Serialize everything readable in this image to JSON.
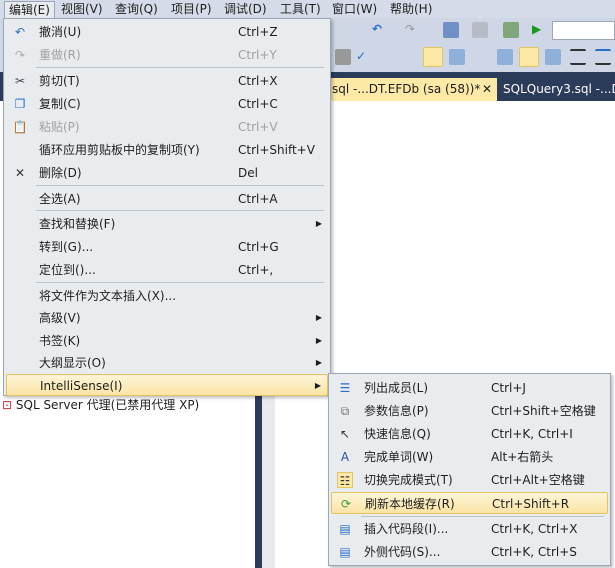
{
  "menubar": [
    "编辑(E)",
    "视图(V)",
    "查询(Q)",
    "项目(P)",
    "调试(D)",
    "工具(T)",
    "窗口(W)",
    "帮助(H)"
  ],
  "tabs": {
    "active": "sql -...DT.EFDb (sa (58))*",
    "close": "✕",
    "second": "SQLQuery3.sql -...D"
  },
  "tree_item": "SQL Server 代理(已禁用代理 XP)",
  "edit_menu": [
    {
      "label": "撤消(U)",
      "shortcut": "Ctrl+Z",
      "icon": "undo-icon"
    },
    {
      "label": "重做(R)",
      "shortcut": "Ctrl+Y",
      "icon": "redo-icon",
      "disabled": true
    },
    {
      "label": "剪切(T)",
      "shortcut": "Ctrl+X",
      "icon": "scissors-icon"
    },
    {
      "label": "复制(C)",
      "shortcut": "Ctrl+C",
      "icon": "copy-icon"
    },
    {
      "label": "粘贴(P)",
      "shortcut": "Ctrl+V",
      "icon": "paste-icon",
      "disabled": true
    },
    {
      "label": "循环应用剪贴板中的复制项(Y)",
      "shortcut": "Ctrl+Shift+V"
    },
    {
      "label": "删除(D)",
      "shortcut": "Del",
      "icon": "delete-icon"
    },
    {
      "label": "全选(A)",
      "shortcut": "Ctrl+A"
    },
    {
      "label": "查找和替换(F)",
      "shortcut": "",
      "submenu": true
    },
    {
      "label": "转到(G)...",
      "shortcut": "Ctrl+G"
    },
    {
      "label": "定位到()...",
      "shortcut": "Ctrl+,"
    },
    {
      "label": "将文件作为文本插入(X)...",
      "shortcut": ""
    },
    {
      "label": "高级(V)",
      "shortcut": "",
      "submenu": true
    },
    {
      "label": "书签(K)",
      "shortcut": "",
      "submenu": true
    },
    {
      "label": "大纲显示(O)",
      "shortcut": "",
      "submenu": true
    },
    {
      "label": "IntelliSense(I)",
      "shortcut": "",
      "submenu": true,
      "highlighted": true
    }
  ],
  "intellisense_menu": [
    {
      "label": "列出成员(L)",
      "shortcut": "Ctrl+J",
      "icon": "list-members-icon"
    },
    {
      "label": "参数信息(P)",
      "shortcut": "Ctrl+Shift+空格键",
      "icon": "parameter-info-icon"
    },
    {
      "label": "快速信息(Q)",
      "shortcut": "Ctrl+K, Ctrl+I",
      "icon": "quick-info-icon"
    },
    {
      "label": "完成单词(W)",
      "shortcut": "Alt+右箭头",
      "icon": "complete-word-icon"
    },
    {
      "label": "切换完成模式(T)",
      "shortcut": "Ctrl+Alt+空格键",
      "icon": "toggle-completion-icon"
    },
    {
      "label": "刷新本地缓存(R)",
      "shortcut": "Ctrl+Shift+R",
      "icon": "refresh-cache-icon",
      "highlighted": true
    },
    {
      "label": "插入代码段(I)...",
      "shortcut": "Ctrl+K, Ctrl+X",
      "icon": "insert-snippet-icon"
    },
    {
      "label": "外侧代码(S)...",
      "shortcut": "Ctrl+K, Ctrl+S",
      "icon": "surround-with-icon"
    }
  ]
}
